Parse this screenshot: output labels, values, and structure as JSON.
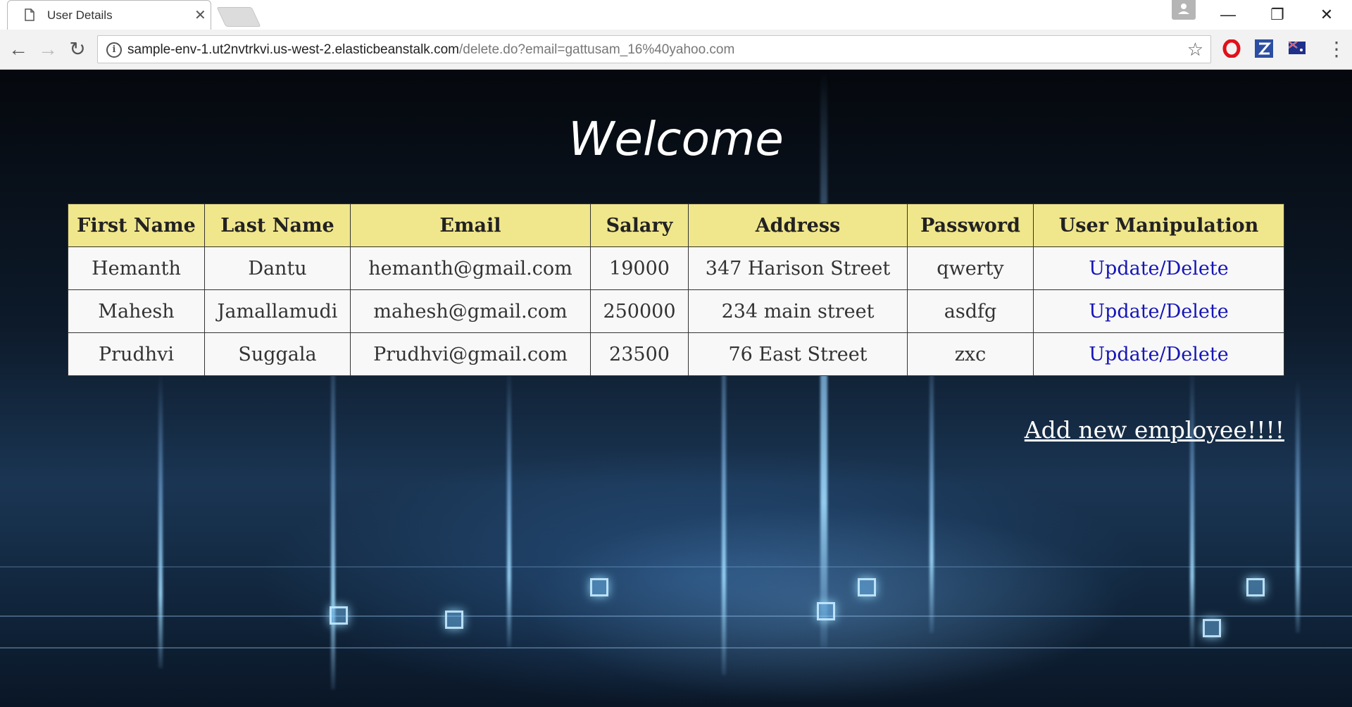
{
  "browser": {
    "tab_title": "User Details",
    "url_host": "sample-env-1.ut2nvtrkvi.us-west-2.elasticbeanstalk.com",
    "url_path": "/delete.do?email=gattusam_16%40yahoo.com",
    "icons": [
      "document-icon",
      "close-icon",
      "back-icon",
      "forward-icon",
      "reload-icon",
      "info-icon",
      "star-icon",
      "opera-icon",
      "zotero-icon",
      "flag-extension-icon",
      "menu-icon"
    ]
  },
  "page": {
    "heading": "Welcome",
    "columns": [
      "First Name",
      "Last Name",
      "Email",
      "Salary",
      "Address",
      "Password",
      "User Manipulation"
    ],
    "rows": [
      [
        "Hemanth",
        "Dantu",
        "hemanth@gmail.com",
        "19000",
        "347 Harison Street",
        "qwerty",
        "Update/Delete"
      ],
      [
        "Mahesh",
        "Jamallamudi",
        "mahesh@gmail.com",
        "250000",
        "234 main street",
        "asdfg",
        "Update/Delete"
      ],
      [
        "Prudhvi",
        "Suggala",
        "Prudhvi@gmail.com",
        "23500",
        "76 East Street",
        "zxc",
        "Update/Delete"
      ]
    ],
    "add_link": "Add new employee!!!!",
    "colors": {
      "header_bg": "#f0e68c",
      "link": "#1515b8",
      "cell_bg": "#f8f8f8"
    }
  }
}
